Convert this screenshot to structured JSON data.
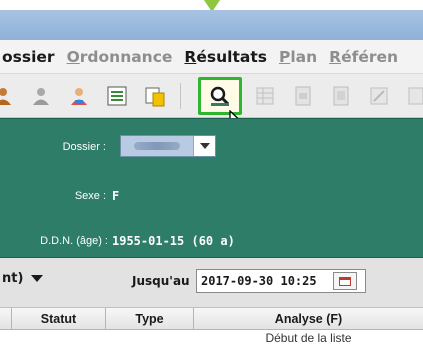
{
  "menu": {
    "items": [
      {
        "label": "ossier",
        "underline": "",
        "enabled": true
      },
      {
        "label": "rdonnance",
        "underline": "O",
        "enabled": false
      },
      {
        "label": "ésultats",
        "underline": "R",
        "enabled": true
      },
      {
        "label": "lan",
        "underline": "P",
        "enabled": false
      },
      {
        "label": "éféren",
        "underline": "R",
        "enabled": false
      }
    ]
  },
  "toolbar": {
    "icons": [
      "person-icon",
      "person-gray-icon",
      "person-color-icon",
      "list-icon",
      "notes-icon",
      "magnifier-icon",
      "grid-icon",
      "document-icon",
      "printer-icon",
      "report-icon"
    ],
    "highlighted": "magnifier-icon",
    "highlight_color": "#2fb52f"
  },
  "patient": {
    "dossier_label": "Dossier :",
    "sexe_label": "Sexe :",
    "sexe_value": "F",
    "ddn_label": "D.D.N. (âge) :",
    "ddn_value": "1955-01-15 (60 a)",
    "panel_color": "#2e7d68"
  },
  "filter": {
    "combo_label": "nt)",
    "until_label": "Jusqu'au",
    "until_value": "2017-09-30 10:25"
  },
  "table": {
    "columns": [
      "Statut",
      "Type",
      "Analyse (F)"
    ],
    "start_text": "Début de la liste"
  }
}
